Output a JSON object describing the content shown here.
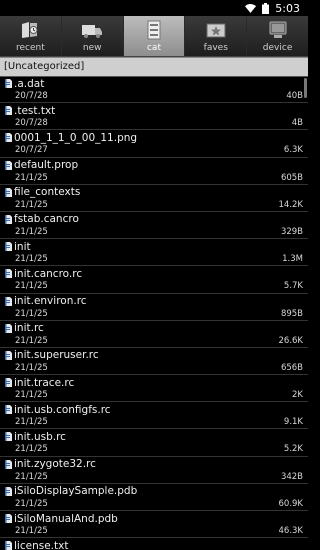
{
  "status_bar": {
    "time": "5:03"
  },
  "tabs": [
    {
      "label": "recent",
      "icon": "recent-icon",
      "active": false
    },
    {
      "label": "new",
      "icon": "new-icon",
      "active": false
    },
    {
      "label": "cat",
      "icon": "cat-icon",
      "active": true
    },
    {
      "label": "faves",
      "icon": "faves-icon",
      "active": false
    },
    {
      "label": "device",
      "icon": "device-icon",
      "active": false
    }
  ],
  "category": {
    "title": "[Uncategorized]"
  },
  "files": [
    {
      "name": ".a.dat",
      "date": "20/7/28",
      "size": "40B"
    },
    {
      "name": ".test.txt",
      "date": "20/7/28",
      "size": "4B"
    },
    {
      "name": "0001_1_1_0_00_11.png",
      "date": "20/7/27",
      "size": "6.3K"
    },
    {
      "name": "default.prop",
      "date": "21/1/25",
      "size": "605B"
    },
    {
      "name": "file_contexts",
      "date": "21/1/25",
      "size": "14.2K"
    },
    {
      "name": "fstab.cancro",
      "date": "21/1/25",
      "size": "329B"
    },
    {
      "name": "init",
      "date": "21/1/25",
      "size": "1.3M"
    },
    {
      "name": "init.cancro.rc",
      "date": "21/1/25",
      "size": "5.7K"
    },
    {
      "name": "init.environ.rc",
      "date": "21/1/25",
      "size": "895B"
    },
    {
      "name": "init.rc",
      "date": "21/1/25",
      "size": "26.6K"
    },
    {
      "name": "init.superuser.rc",
      "date": "21/1/25",
      "size": "656B"
    },
    {
      "name": "init.trace.rc",
      "date": "21/1/25",
      "size": "2K"
    },
    {
      "name": "init.usb.configfs.rc",
      "date": "21/1/25",
      "size": "9.1K"
    },
    {
      "name": "init.usb.rc",
      "date": "21/1/25",
      "size": "5.2K"
    },
    {
      "name": "init.zygote32.rc",
      "date": "21/1/25",
      "size": "342B"
    },
    {
      "name": "iSiloDisplaySample.pdb",
      "date": "21/1/25",
      "size": "60.9K"
    },
    {
      "name": "iSiloManualAnd.pdb",
      "date": "21/1/25",
      "size": "46.3K"
    },
    {
      "name": "license.txt",
      "date": "",
      "size": ""
    }
  ]
}
